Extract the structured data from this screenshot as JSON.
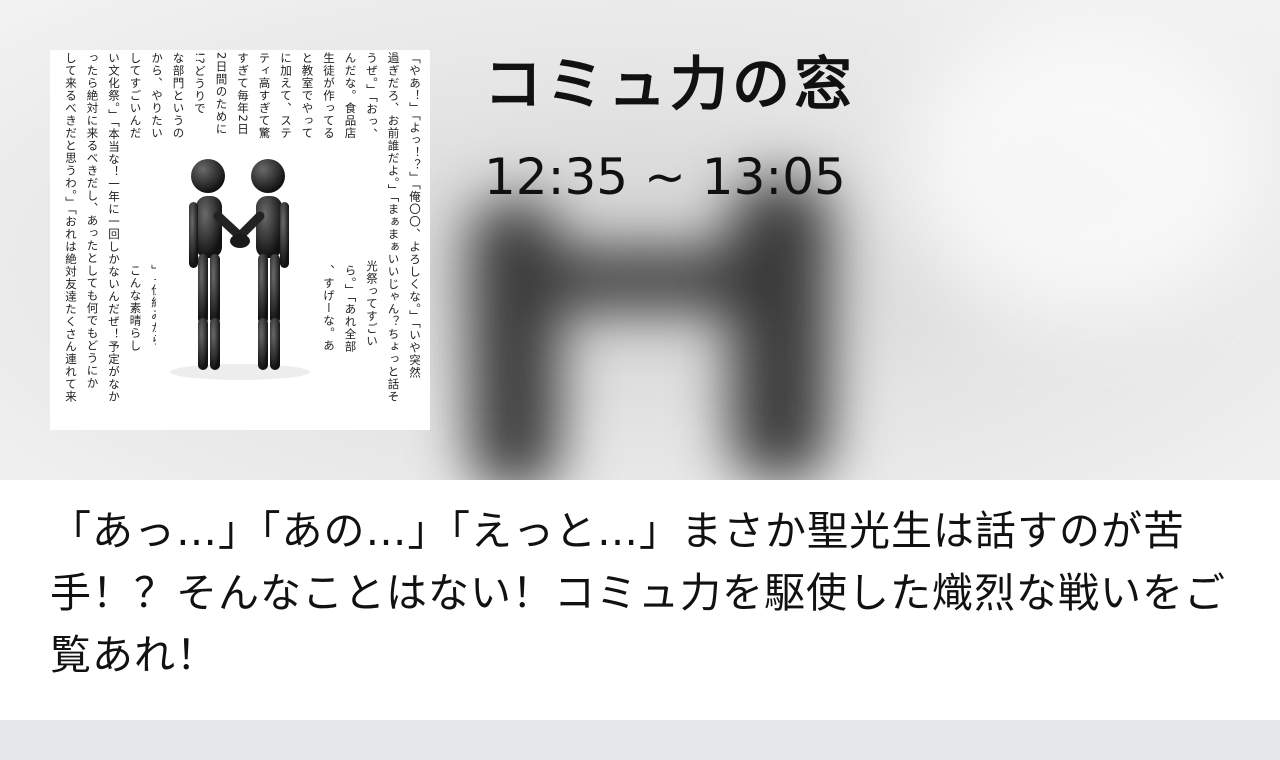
{
  "program": {
    "title": "コミュ力の窓",
    "time": "12:35 ~ 13:05",
    "description": "「あっ…」「あの…」「えっと…」まさか聖光生は話すのが苦手！？そんなことはない！コミュ力を駆使した熾烈な戦いをご覧あれ！"
  },
  "thumbnail": {
    "icon": "handshake-figures-icon",
    "columns": [
      "「やあ！」「よっ！？」「俺〇〇、よろしくな。」「いや突然",
      "過ぎだろ、お前誰だよ。」「まぁまぁいいじゃん？ちょっと話そ",
      "うぜ。」「おっ、　　　　　　　　　　光祭ってすごい",
      "んだな。食品店　　　　　　　　　　ら。」「あれ全部",
      "生徒が作ってる　　　　　　　　　　、すげーな。あ",
      "と教室でやって　　　　　　　　　　じゃない。それ",
      "に加えて、ステ　　　　　　　　　　文化祭のクオリ",
      "ティ高すぎて驚　　　　　　　　　　かる。俺も楽し",
      "すぎて毎年2日　　　　　　　　　　ると生徒はこの",
      "2日間のために　　　　　　　　　　ってな。」「え",
      "!?どうりで　　　　　　　　　　でなんか、様々",
      "な部門というの　　　　　　　　　　に任されている",
      "から、やりたい　　　　　　　　　　」「仕組みから",
      "してすごいんだ　　　　　　　　　　こんな素晴らし",
      "い文化祭。」「本当な！一年に一回しかないんだぜ！予定がなか",
      "ったら絶対に来るべきだし、あったとしても何でもどうにか",
      "して来るべきだと思うわ。」「おれは絶対友達たくさん連れて来"
    ]
  }
}
